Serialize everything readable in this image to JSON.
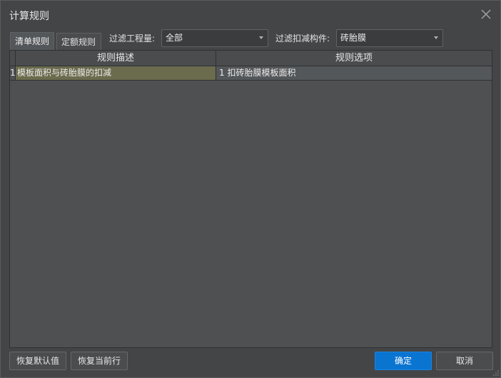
{
  "window": {
    "title": "计算规则"
  },
  "tabs": [
    {
      "label": "清单规则",
      "active": true
    },
    {
      "label": "定额规则",
      "active": false
    }
  ],
  "filters": {
    "quantity": {
      "label": "过滤工程量:",
      "value": "全部"
    },
    "deduct": {
      "label": "过滤扣减构件:",
      "value": "砖胎膜"
    }
  },
  "table": {
    "columns": [
      "规则描述",
      "规则选项"
    ],
    "rows": [
      {
        "index": "1",
        "description": "模板面积与砖胎膜的扣减",
        "option": "1 扣砖胎膜模板面积"
      }
    ]
  },
  "buttons": {
    "restore_default": "恢复默认值",
    "restore_row": "恢复当前行",
    "ok": "确定",
    "cancel": "取消"
  },
  "colors": {
    "accent": "#0a74d1",
    "selected_cell": "#6b6b4e"
  }
}
